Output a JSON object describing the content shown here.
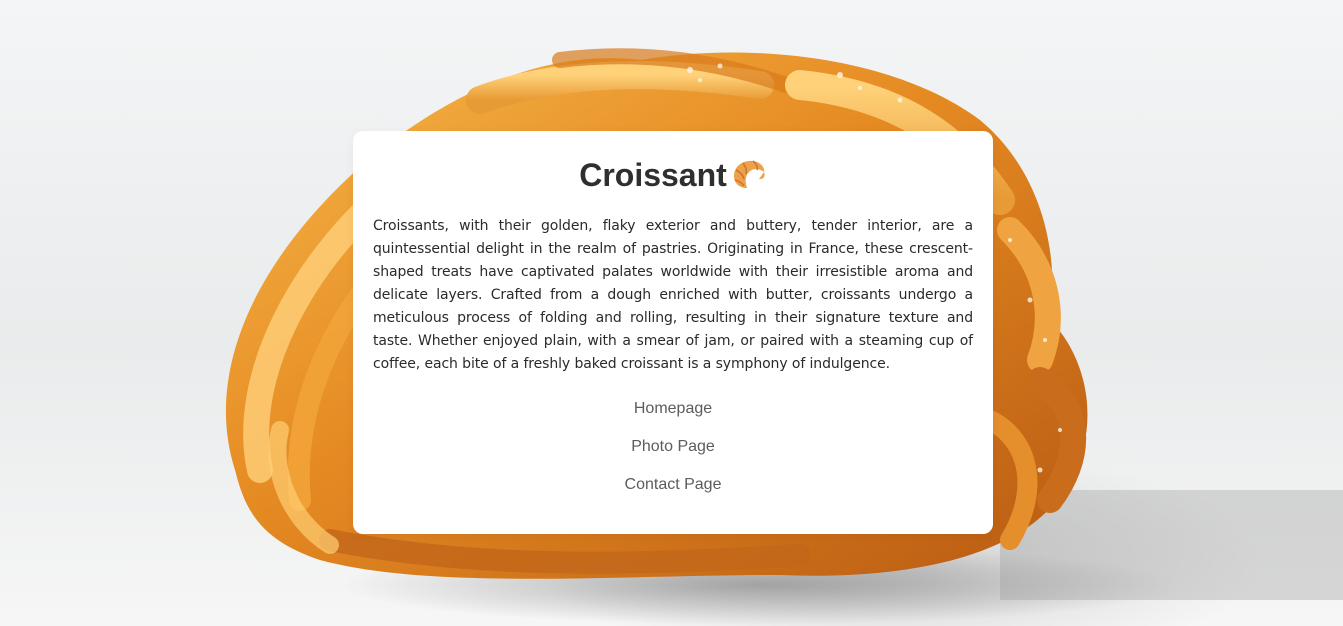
{
  "page": {
    "title": "Croissant"
  },
  "card": {
    "heading": "Croissant",
    "heading_icon": "croissant-icon",
    "description": "Croissants, with their golden, flaky exterior and buttery, tender interior, are a quintessential delight in the realm of pastries. Originating in France, these crescent-shaped treats have captivated palates worldwide with their irresistible aroma and delicate layers. Crafted from a dough enriched with butter, croissants undergo a meticulous process of folding and rolling, resulting in their signature texture and taste. Whether enjoyed plain, with a smear of jam, or paired with a steaming cup of coffee, each bite of a freshly baked croissant is a symphony of indulgence."
  },
  "nav": {
    "links": [
      {
        "label": "Homepage"
      },
      {
        "label": "Photo Page"
      },
      {
        "label": "Contact Page"
      }
    ]
  },
  "colors": {
    "card_background": "#ffffff",
    "heading_text": "#2f2f2f",
    "body_text": "#2a2a2a",
    "link_text": "#5c5c5c",
    "croissant_gold": "#e8952e"
  }
}
